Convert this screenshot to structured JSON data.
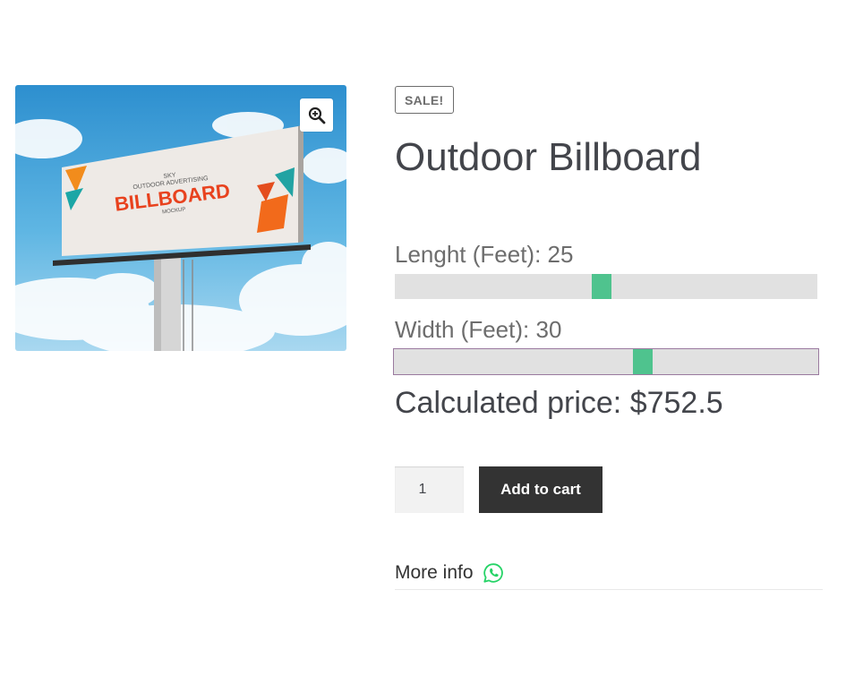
{
  "product": {
    "sale_badge": "SALE!",
    "title": "Outdoor Billboard",
    "image": {
      "billboard_small_top": "SKY",
      "billboard_subtitle": "OUTDOOR ADVERTISING",
      "billboard_main": "BILLBOARD",
      "billboard_tag": "MOCKUP",
      "sky_color": "#4fa9d9"
    }
  },
  "controls": {
    "length": {
      "label": "Lenght (Feet): ",
      "value": "25",
      "level": 0.5
    },
    "width": {
      "label": "Width (Feet): ",
      "value": "30",
      "level": 0.6
    },
    "price_label": "Calculated price: ",
    "price_value": "$752.5",
    "quantity": "1",
    "add_to_cart": "Add to cart",
    "more_info": "More info"
  },
  "colors": {
    "accent": "#4fc38e",
    "button_bg": "#333333",
    "text": "#43454b",
    "whatsapp": "#25d366"
  },
  "icons": {
    "zoom": "zoom-in-icon",
    "whatsapp": "whatsapp-icon"
  }
}
